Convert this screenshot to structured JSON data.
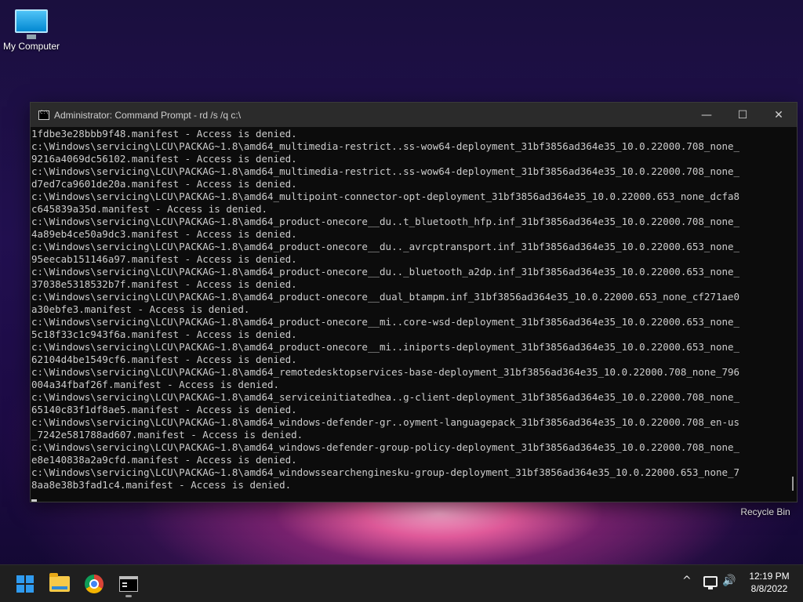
{
  "desktop": {
    "icons": [
      {
        "label": "My Computer",
        "icon": "monitor-icon"
      },
      {
        "label": "Recycle Bin",
        "icon": "recycle-bin-icon"
      }
    ]
  },
  "window": {
    "title": "Administrator: Command Prompt - rd  /s /q c:\\",
    "controls": {
      "minimize": "—",
      "maximize": "☐",
      "close": "✕"
    },
    "console_lines": [
      "1fdbe3e28bbb9f48.manifest - Access is denied.",
      "c:\\Windows\\servicing\\LCU\\PACKAG~1.8\\amd64_multimedia-restrict..ss-wow64-deployment_31bf3856ad364e35_10.0.22000.708_none_",
      "9216a4069dc56102.manifest - Access is denied.",
      "c:\\Windows\\servicing\\LCU\\PACKAG~1.8\\amd64_multimedia-restrict..ss-wow64-deployment_31bf3856ad364e35_10.0.22000.708_none_",
      "d7ed7ca9601de20a.manifest - Access is denied.",
      "c:\\Windows\\servicing\\LCU\\PACKAG~1.8\\amd64_multipoint-connector-opt-deployment_31bf3856ad364e35_10.0.22000.653_none_dcfa8",
      "c645839a35d.manifest - Access is denied.",
      "c:\\Windows\\servicing\\LCU\\PACKAG~1.8\\amd64_product-onecore__du..t_bluetooth_hfp.inf_31bf3856ad364e35_10.0.22000.708_none_",
      "4a89eb4ce50a9dc3.manifest - Access is denied.",
      "c:\\Windows\\servicing\\LCU\\PACKAG~1.8\\amd64_product-onecore__du.._avrcptransport.inf_31bf3856ad364e35_10.0.22000.653_none_",
      "95eecab151146a97.manifest - Access is denied.",
      "c:\\Windows\\servicing\\LCU\\PACKAG~1.8\\amd64_product-onecore__du.._bluetooth_a2dp.inf_31bf3856ad364e35_10.0.22000.653_none_",
      "37038e5318532b7f.manifest - Access is denied.",
      "c:\\Windows\\servicing\\LCU\\PACKAG~1.8\\amd64_product-onecore__dual_btampm.inf_31bf3856ad364e35_10.0.22000.653_none_cf271ae0",
      "a30ebfe3.manifest - Access is denied.",
      "c:\\Windows\\servicing\\LCU\\PACKAG~1.8\\amd64_product-onecore__mi..core-wsd-deployment_31bf3856ad364e35_10.0.22000.653_none_",
      "5c18f33c1c943f6a.manifest - Access is denied.",
      "c:\\Windows\\servicing\\LCU\\PACKAG~1.8\\amd64_product-onecore__mi..iniports-deployment_31bf3856ad364e35_10.0.22000.653_none_",
      "62104d4be1549cf6.manifest - Access is denied.",
      "c:\\Windows\\servicing\\LCU\\PACKAG~1.8\\amd64_remotedesktopservices-base-deployment_31bf3856ad364e35_10.0.22000.708_none_796",
      "004a34fbaf26f.manifest - Access is denied.",
      "c:\\Windows\\servicing\\LCU\\PACKAG~1.8\\amd64_serviceinitiatedhea..g-client-deployment_31bf3856ad364e35_10.0.22000.708_none_",
      "65140c83f1df8ae5.manifest - Access is denied.",
      "c:\\Windows\\servicing\\LCU\\PACKAG~1.8\\amd64_windows-defender-gr..oyment-languagepack_31bf3856ad364e35_10.0.22000.708_en-us",
      "_7242e581788ad607.manifest - Access is denied.",
      "c:\\Windows\\servicing\\LCU\\PACKAG~1.8\\amd64_windows-defender-group-policy-deployment_31bf3856ad364e35_10.0.22000.708_none_",
      "e8e140838a2a9cfd.manifest - Access is denied.",
      "c:\\Windows\\servicing\\LCU\\PACKAG~1.8\\amd64_windowssearchenginesku-group-deployment_31bf3856ad364e35_10.0.22000.653_none_7",
      "8aa8e38b3fad1c4.manifest - Access is denied."
    ]
  },
  "taskbar": {
    "apps": [
      "start-icon",
      "file-explorer-icon",
      "chrome-icon",
      "command-prompt-icon"
    ],
    "clock": {
      "time": "12:19 PM",
      "date": "8/8/2022"
    }
  },
  "colors": {
    "console_bg": "#0c0c0c",
    "console_fg": "#cccccc",
    "titlebar_bg": "#2b2b2b",
    "taskbar_bg": "#1f1f1f",
    "start_blue": "#2f9bf0"
  }
}
